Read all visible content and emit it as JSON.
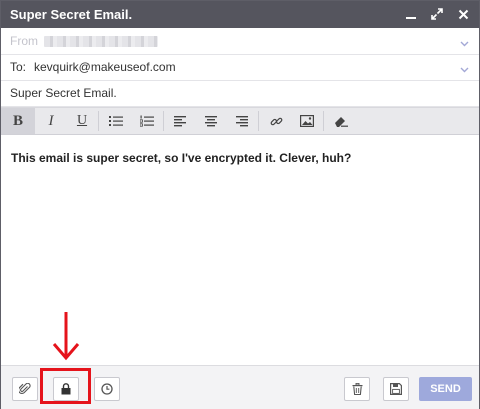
{
  "window": {
    "title": "Super Secret Email."
  },
  "fields": {
    "from_label": "From",
    "to_label": "To:",
    "to_value": "kevquirk@makeuseof.com",
    "subject_value": "Super Secret Email."
  },
  "body": {
    "text": "This email is super secret, so I've encrypted it. Clever, huh?"
  },
  "toolbar": {
    "bold": "B",
    "italic": "I",
    "underline": "U"
  },
  "footer": {
    "send_label": "SEND"
  },
  "colors": {
    "titlebar": "#55555e",
    "send_button": "#9ea9dc",
    "highlight": "#e5131b",
    "toolbar_bg": "#e9e9ec"
  },
  "icons": {
    "titlebar": [
      "minimize-icon",
      "expand-icon",
      "close-icon"
    ],
    "toolbar": [
      "bullet-list-icon",
      "numbered-list-icon",
      "align-left-icon",
      "align-center-icon",
      "align-right-icon",
      "link-icon",
      "image-icon",
      "eraser-icon"
    ],
    "footer": [
      "paperclip-icon",
      "lock-icon",
      "clock-icon",
      "trash-icon",
      "save-icon"
    ]
  }
}
